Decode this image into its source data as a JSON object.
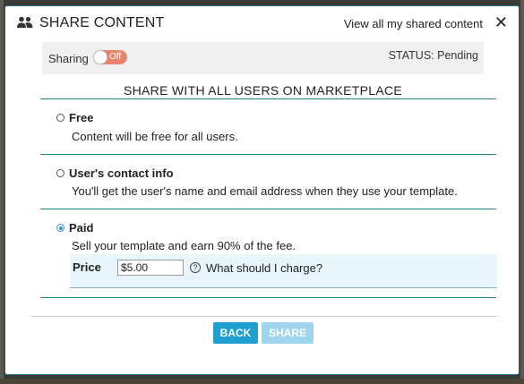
{
  "header": {
    "title": "SHARE CONTENT",
    "view_all_link": "View all my shared content",
    "close_glyph": "✕"
  },
  "sharing": {
    "label": "Sharing",
    "toggle_state": "Off",
    "status": "STATUS: Pending"
  },
  "marketplace": {
    "heading": "SHARE WITH ALL USERS ON MARKETPLACE",
    "options": [
      {
        "title": "Free",
        "description": "Content will be free for all users.",
        "selected": false
      },
      {
        "title": "User's contact info",
        "description": "You'll get the user's name and email address when they use your template.",
        "selected": false
      },
      {
        "title": "Paid",
        "description": "Sell your template and earn 90% of the fee.",
        "selected": true
      }
    ],
    "price": {
      "label": "Price",
      "value": "$5.00",
      "help_glyph": "?",
      "help_text": "What should I charge?"
    }
  },
  "buttons": {
    "back": "BACK",
    "share": "SHARE"
  },
  "icons": {
    "header_icon": "users-icon",
    "help_icon": "question-circle-icon",
    "close_icon": "close-icon"
  },
  "colors": {
    "accent": "#1f9fd0",
    "accent_disabled": "#9fd5ec",
    "toggle_off": "#e8846e",
    "rule": "#2a7f8f",
    "price_row_bg": "#e8f6fb"
  }
}
